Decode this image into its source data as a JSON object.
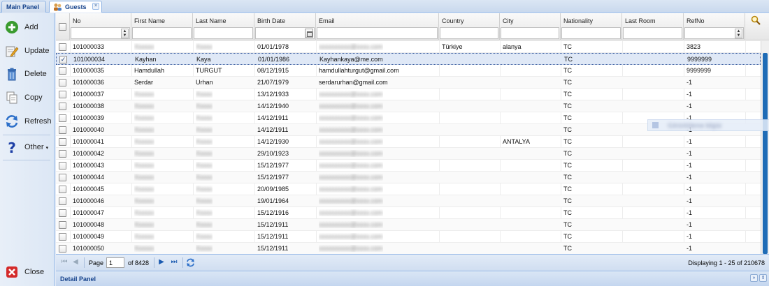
{
  "tabs": {
    "main": "Main Panel",
    "guests": "Guests",
    "close": "×"
  },
  "toolbar": {
    "add": "Add",
    "update": "Update",
    "delete": "Delete",
    "copy": "Copy",
    "refresh": "Refresh",
    "other": "Other",
    "close": "Close"
  },
  "grid": {
    "columns": {
      "no": "No",
      "first": "First Name",
      "last": "Last Name",
      "birth": "Birth Date",
      "email": "Email",
      "country": "Country",
      "city": "City",
      "nationality": "Nationality",
      "lastroom": "Last Room",
      "refno": "RefNo"
    },
    "rows": [
      {
        "no": "101000033",
        "first": "",
        "last": "",
        "birth": "01/01/1978",
        "email": "",
        "country": "Türkiye",
        "city": "alanya",
        "nat": "TC",
        "ref": "3823"
      },
      {
        "no": "101000034",
        "first": "Kayhan",
        "last": "Kaya",
        "birth": "01/01/1986",
        "email": "Kayhankaya@me.com",
        "country": "",
        "city": "",
        "nat": "TC",
        "ref": "9999999",
        "selected": true
      },
      {
        "no": "101000035",
        "first": "Hamdullah",
        "last": "TURGUT",
        "birth": "08/12/1915",
        "email": "hamdullahturgut@gmail.com",
        "country": "",
        "city": "",
        "nat": "TC",
        "ref": "9999999"
      },
      {
        "no": "101000036",
        "first": "Serdar",
        "last": "Urhan",
        "birth": "21/07/1979",
        "email": "serdarurhan@gmail.com",
        "country": "",
        "city": "",
        "nat": "TC",
        "ref": "-1"
      },
      {
        "no": "101000037",
        "first": "",
        "last": "",
        "birth": "13/12/1933",
        "email": "",
        "country": "",
        "city": "",
        "nat": "TC",
        "ref": "-1"
      },
      {
        "no": "101000038",
        "first": "",
        "last": "",
        "birth": "14/12/1940",
        "email": "",
        "country": "",
        "city": "",
        "nat": "TC",
        "ref": "-1"
      },
      {
        "no": "101000039",
        "first": "",
        "last": "",
        "birth": "14/12/1911",
        "email": "",
        "country": "",
        "city": "",
        "nat": "TC",
        "ref": "-1"
      },
      {
        "no": "101000040",
        "first": "",
        "last": "",
        "birth": "14/12/1911",
        "email": "",
        "country": "",
        "city": "",
        "nat": "TC",
        "ref": "-1"
      },
      {
        "no": "101000041",
        "first": "",
        "last": "",
        "birth": "14/12/1930",
        "email": "",
        "country": "",
        "city": "ANTALYA",
        "nat": "TC",
        "ref": "-1"
      },
      {
        "no": "101000042",
        "first": "",
        "last": "",
        "birth": "29/10/1923",
        "email": "",
        "country": "",
        "city": "",
        "nat": "TC",
        "ref": "-1"
      },
      {
        "no": "101000043",
        "first": "",
        "last": "",
        "birth": "15/12/1977",
        "email": "",
        "country": "",
        "city": "",
        "nat": "TC",
        "ref": "-1"
      },
      {
        "no": "101000044",
        "first": "",
        "last": "",
        "birth": "15/12/1977",
        "email": "",
        "country": "",
        "city": "",
        "nat": "TC",
        "ref": "-1"
      },
      {
        "no": "101000045",
        "first": "",
        "last": "",
        "birth": "20/09/1985",
        "email": "",
        "country": "",
        "city": "",
        "nat": "TC",
        "ref": "-1"
      },
      {
        "no": "101000046",
        "first": "",
        "last": "",
        "birth": "19/01/1964",
        "email": "",
        "country": "",
        "city": "",
        "nat": "TC",
        "ref": "-1"
      },
      {
        "no": "101000047",
        "first": "",
        "last": "",
        "birth": "15/12/1916",
        "email": "",
        "country": "",
        "city": "",
        "nat": "TC",
        "ref": "-1"
      },
      {
        "no": "101000048",
        "first": "",
        "last": "",
        "birth": "15/12/1911",
        "email": "",
        "country": "",
        "city": "",
        "nat": "TC",
        "ref": "-1"
      },
      {
        "no": "101000049",
        "first": "",
        "last": "",
        "birth": "15/12/1911",
        "email": "",
        "country": "",
        "city": "",
        "nat": "TC",
        "ref": "-1"
      },
      {
        "no": "101000050",
        "first": "",
        "last": "",
        "birth": "15/12/1911",
        "email": "",
        "country": "",
        "city": "",
        "nat": "TC",
        "ref": "-1"
      }
    ]
  },
  "pager": {
    "page_label": "Page",
    "page_value": "1",
    "of_text": "of 8428",
    "display_text": "Displaying 1 - 25 of 210678"
  },
  "detail": {
    "title": "Detail Panel"
  },
  "icons": {
    "add": "add-circle-icon",
    "update": "edit-icon",
    "delete": "trash-icon",
    "copy": "copy-icon",
    "refresh": "refresh-icon",
    "other": "help-icon",
    "close": "close-icon"
  },
  "colors": {
    "accent": "#15428b",
    "selection": "#dfe8f6",
    "scroll": "#1f6cb6"
  }
}
